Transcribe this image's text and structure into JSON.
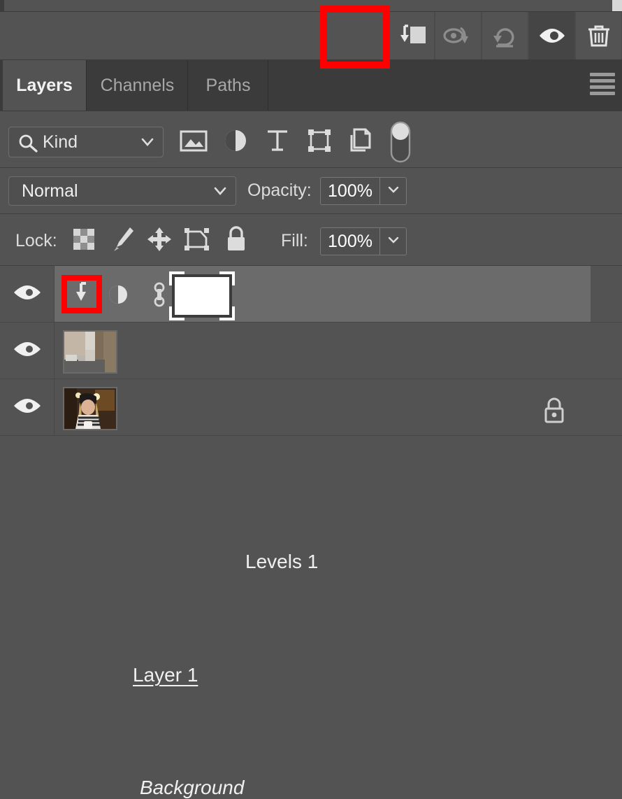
{
  "app": {
    "panel_title": "Layers"
  },
  "toolbar": {
    "buttons": [
      {
        "name": "create-clipping-mask-button",
        "icon": "clipping-mask-icon",
        "label": "Create Clipping Mask",
        "highlighted": true
      },
      {
        "name": "link-layers-button",
        "icon": "eye-rotate-icon",
        "label": "Link layers",
        "highlighted": false
      },
      {
        "name": "undo-button",
        "icon": "undo-arrow-icon",
        "label": "Undo",
        "highlighted": false
      },
      {
        "name": "toggle-visibility-button",
        "icon": "eye-icon",
        "label": "Toggle visibility",
        "highlighted": true
      },
      {
        "name": "delete-layer-button",
        "icon": "trash-icon",
        "label": "Delete layer",
        "highlighted": false
      }
    ]
  },
  "tabs": [
    {
      "label": "Layers",
      "active": true
    },
    {
      "label": "Channels",
      "active": false
    },
    {
      "label": "Paths",
      "active": false
    }
  ],
  "panel_menu": {
    "icon": "hamburger-menu-icon",
    "label": "Panel menu"
  },
  "filter": {
    "kind_label": "Kind",
    "search_icon": "search-icon",
    "chevron_icon": "chevron-down-icon",
    "type_icons": [
      {
        "name": "filter-pixel-layers",
        "icon": "image-icon"
      },
      {
        "name": "filter-adjustment-layers",
        "icon": "adjustment-circle-icon"
      },
      {
        "name": "filter-type-layers",
        "icon": "text-t-icon"
      },
      {
        "name": "filter-shape-layers",
        "icon": "shape-icon"
      },
      {
        "name": "filter-smart-objects",
        "icon": "smart-object-icon"
      }
    ],
    "toggle": {
      "name": "filter-enable-toggle",
      "icon": "toggle-switch-icon",
      "state": "on"
    }
  },
  "blend": {
    "mode": "Normal",
    "opacity_label": "Opacity:",
    "opacity_value": "100%",
    "chevron_icon": "chevron-down-icon"
  },
  "lock": {
    "label": "Lock:",
    "icons": [
      {
        "name": "lock-transparent-pixels",
        "icon": "checkerboard-icon"
      },
      {
        "name": "lock-image-pixels",
        "icon": "paintbrush-icon"
      },
      {
        "name": "lock-position",
        "icon": "move-arrows-icon"
      },
      {
        "name": "lock-artboard-nesting",
        "icon": "artboard-icon"
      },
      {
        "name": "lock-all",
        "icon": "padlock-icon"
      }
    ],
    "fill_label": "Fill:",
    "fill_value": "100%"
  },
  "layers": [
    {
      "name": "Levels 1",
      "selected": true,
      "visible": true,
      "visibility_icon": "eye-icon",
      "clipping_icon": "clipping-arrow-icon",
      "kind_icon": "adjustment-circle-icon",
      "link_icon": "chain-link-icon",
      "thumbnail": "white-mask-thumbnail",
      "mask_selected": true,
      "italic": false,
      "underline": false,
      "locked": false
    },
    {
      "name": "Layer 1",
      "selected": false,
      "visible": true,
      "visibility_icon": "eye-icon",
      "thumbnail": "street-photo-thumbnail",
      "italic": false,
      "underline": true,
      "locked": false
    },
    {
      "name": "Background",
      "selected": false,
      "visible": true,
      "visibility_icon": "eye-icon",
      "thumbnail": "portrait-photo-thumbnail",
      "italic": true,
      "underline": false,
      "locked": true,
      "lock_icon": "padlock-icon"
    }
  ],
  "annotations": [
    {
      "name": "callout-toolbar-clipping-mask",
      "color": "#fe0000",
      "target": "create-clipping-mask-button"
    },
    {
      "name": "callout-layer-clipping-indicator",
      "color": "#fe0000",
      "target": "levels-clipping-icon"
    }
  ],
  "colors": {
    "panel_bg": "#535353",
    "tabbar_bg": "#3b3b3b",
    "selected_row": "#6b6b6b",
    "accent_red": "#fe0000",
    "text": "#f0f0f0"
  }
}
